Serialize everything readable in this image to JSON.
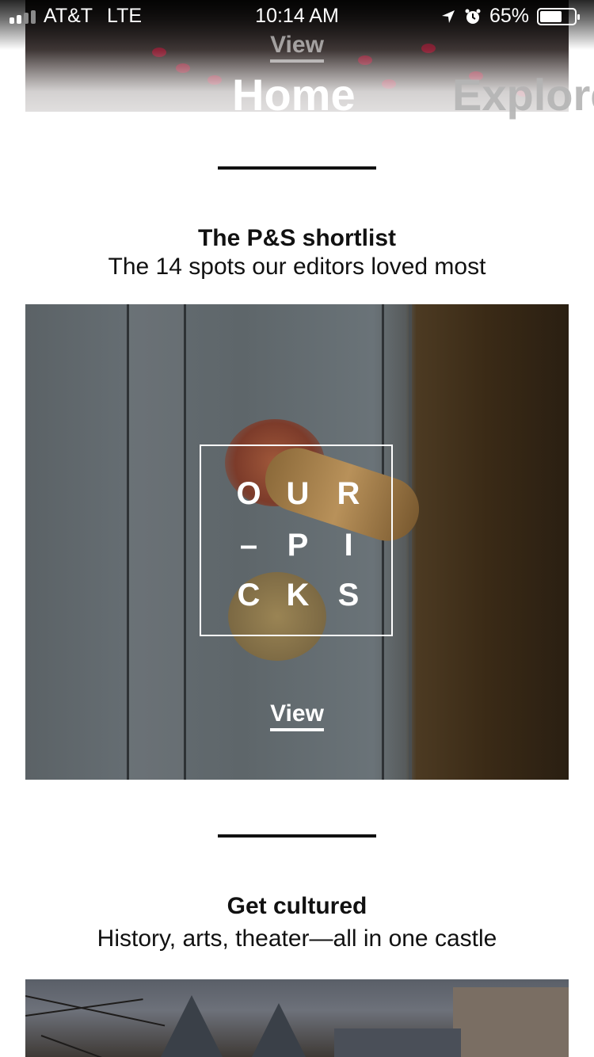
{
  "status_bar": {
    "carrier": "AT&T",
    "network": "LTE",
    "time": "10:14 AM",
    "battery_percent": "65%",
    "battery_level": 0.65,
    "icons": [
      "signal-icon",
      "location-arrow-icon",
      "alarm-icon",
      "battery-icon"
    ]
  },
  "header": {
    "top_card_view_label": "View",
    "tabs": [
      {
        "label": "Home",
        "active": true
      },
      {
        "label": "Explore",
        "active": false
      }
    ]
  },
  "sections": [
    {
      "title": "The P&S shortlist",
      "subtitle": "The 14 spots our editors loved most",
      "card": {
        "overlay_letters": [
          "O",
          "U",
          "R",
          "–",
          "P",
          "I",
          "C",
          "K",
          "S"
        ],
        "view_label": "View"
      }
    },
    {
      "title": "Get cultured",
      "subtitle": "History, arts, theater—all in one castle"
    }
  ]
}
